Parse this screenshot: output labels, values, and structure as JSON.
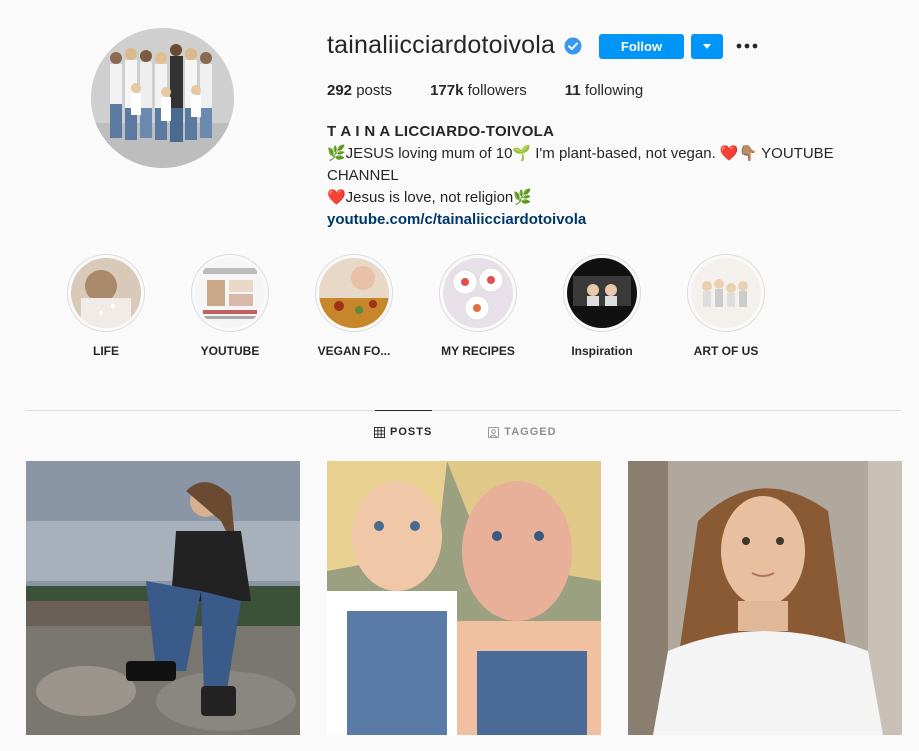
{
  "profile": {
    "username": "tainaliicciardotoivola",
    "follow_label": "Follow",
    "stats": {
      "posts_count": "292",
      "posts_label": " posts",
      "followers_count": "177k",
      "followers_label": " followers",
      "following_count": "11",
      "following_label": " following"
    },
    "bio": {
      "name": "T A I N A LICCIARDO-TOIVOLA",
      "line1": "🌿JESUS loving mum of 10🌱 I'm plant-based, not vegan. ❤️👇🏽 YOUTUBE CHANNEL",
      "line2": "❤️Jesus is love, not religion🌿",
      "link": "youtube.com/c/tainaliicciardotoivola"
    }
  },
  "highlights": [
    {
      "label": "LIFE",
      "icon": "highlight-life-image"
    },
    {
      "label": "YOUTUBE",
      "icon": "highlight-youtube-image"
    },
    {
      "label": "VEGAN FO...",
      "icon": "highlight-vegan-image"
    },
    {
      "label": "MY RECIPES",
      "icon": "highlight-recipes-image"
    },
    {
      "label": "Inspiration",
      "icon": "highlight-inspiration-image"
    },
    {
      "label": "ART OF US",
      "icon": "highlight-art-image"
    }
  ],
  "tabs": [
    {
      "label": "POSTS",
      "icon": "grid-icon",
      "active": true
    },
    {
      "label": "TAGGED",
      "icon": "tagged-icon",
      "active": false
    }
  ],
  "colors": {
    "accent": "#0095f6",
    "link": "#00376b",
    "verified": "#3897f0"
  }
}
